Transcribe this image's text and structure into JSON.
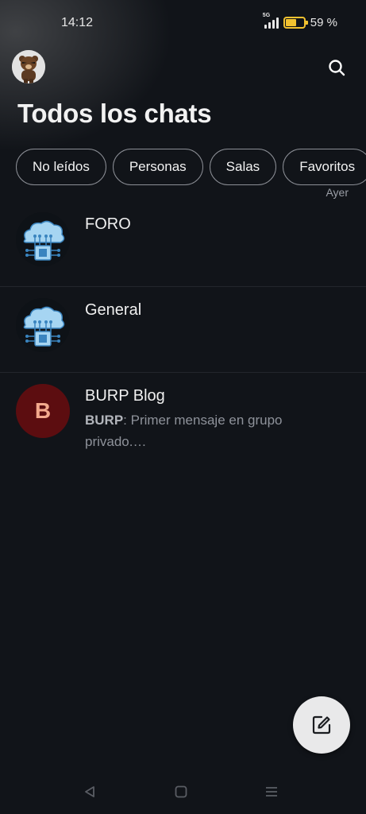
{
  "status_bar": {
    "time": "14:12",
    "network": "5G",
    "battery_percent": "59 %",
    "battery_level": 0.59,
    "colors": {
      "battery": "#f2c230"
    }
  },
  "header": {
    "title": "Todos los chats",
    "avatar_icon": "user-avatar-bear",
    "search_icon": "search-icon"
  },
  "filters": [
    {
      "label": "No leídos"
    },
    {
      "label": "Personas"
    },
    {
      "label": "Salas"
    },
    {
      "label": "Favoritos"
    }
  ],
  "chats": [
    {
      "name": "FORO",
      "avatar": "cloud-chip-icon"
    },
    {
      "name": "General",
      "avatar": "cloud-chip-icon"
    },
    {
      "name": "BURP Blog",
      "avatar_letter": "B",
      "time": "Ayer",
      "preview_sender": "BURP",
      "preview_text": ": Primer mensaje en grupo privado.…"
    }
  ],
  "fab": {
    "icon": "compose-icon"
  },
  "colors": {
    "background": "#111419",
    "letter_avatar_bg": "#5c0d10",
    "letter_avatar_fg": "#f3a98d",
    "fab_bg": "#e9e9ea"
  }
}
